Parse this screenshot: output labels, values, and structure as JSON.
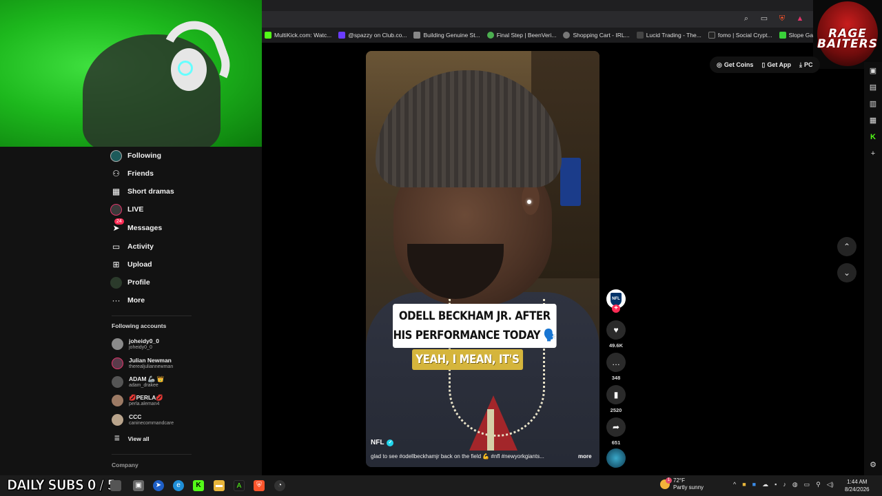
{
  "bookmarks": [
    {
      "label": "MultiKick.com: Watc...",
      "icon": "kick-icon",
      "color": "#53fc18"
    },
    {
      "label": "@spazzy on Club.co...",
      "icon": "club-icon",
      "color": "#6a3cff"
    },
    {
      "label": "Building Genuine St...",
      "icon": "page-icon",
      "color": "#888888"
    },
    {
      "label": "Final Step | BeenVeri...",
      "icon": "beenverified-icon",
      "color": "#4caf50"
    },
    {
      "label": "Shopping Cart - IRL...",
      "icon": "globe-icon",
      "color": "#777777"
    },
    {
      "label": "Lucid Trading - The...",
      "icon": "lucid-icon",
      "color": "#444444"
    },
    {
      "label": "fomo | Social Crypt...",
      "icon": "fomo-icon",
      "color": "#222222"
    },
    {
      "label": "Slope Game",
      "icon": "slope-icon",
      "color": "#3ad13a"
    }
  ],
  "logo": {
    "text": "RAGE BAITERS"
  },
  "header": {
    "get_coins": "Get Coins",
    "get_app": "Get App",
    "pc": "PC"
  },
  "sidebar": {
    "items": [
      {
        "label": "Following",
        "icon": "following-avatar-icon"
      },
      {
        "label": "Friends",
        "icon": "friends-icon"
      },
      {
        "label": "Short dramas",
        "icon": "short-dramas-icon"
      },
      {
        "label": "LIVE",
        "icon": "live-icon"
      },
      {
        "label": "Messages",
        "icon": "messages-icon",
        "badge": "24"
      },
      {
        "label": "Activity",
        "icon": "activity-icon"
      },
      {
        "label": "Upload",
        "icon": "upload-icon"
      },
      {
        "label": "Profile",
        "icon": "profile-icon"
      },
      {
        "label": "More",
        "icon": "more-icon"
      }
    ],
    "following_title": "Following accounts",
    "accounts": [
      {
        "name": "joheidy0_0",
        "handle": "joheidy0_0"
      },
      {
        "name": "Julian Newman",
        "handle": "therealjuliannewman"
      },
      {
        "name": "ADAM 🦾 👑",
        "handle": "adam_drakee"
      },
      {
        "name": "💋PERLA💋",
        "handle": "perla.aleman4"
      },
      {
        "name": "CCC",
        "handle": "caninecommandcare"
      }
    ],
    "view_all": "View all",
    "company": "Company"
  },
  "video": {
    "caption_top": "ODELL BECKHAM JR. AFTER HIS PERFORMANCE TODAY 🗣️",
    "caption_line1": "ODELL BECKHAM JR. AFTER",
    "caption_line2": "HIS PERFORMANCE TODAY 🗣️",
    "caption_yellow": "YEAH, I MEAN, IT'S",
    "author": "NFL",
    "description": "glad to see #odellbeckhamjr back on the field 💪 #nfl #newyorkgiants...",
    "more": "more"
  },
  "actions": {
    "author_logo": "NFL",
    "likes": "49.6K",
    "comments": "348",
    "saves": "2520",
    "shares": "651"
  },
  "taskbar": {
    "subs": "DAILY SUBS 0 / 5",
    "weather_temp": "72°F",
    "weather_desc": "Partly sunny",
    "weather_badge": "1",
    "time": "1:44 AM",
    "date": "8/24/2026"
  }
}
